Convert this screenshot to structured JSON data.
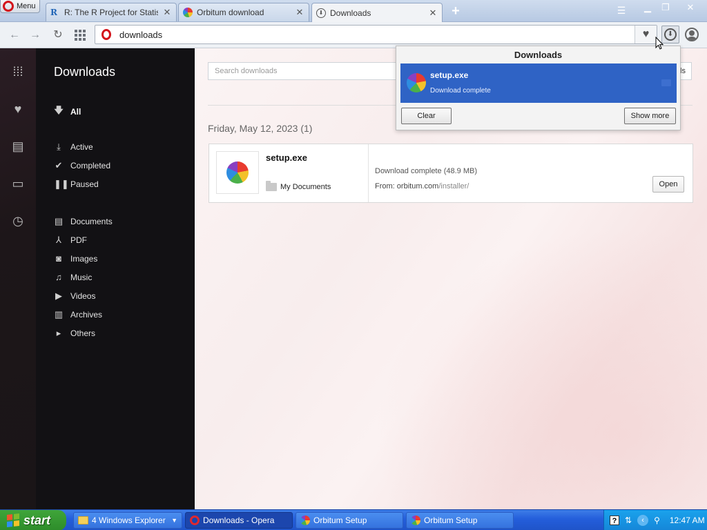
{
  "browser": {
    "menu_label": "Menu",
    "tabs": [
      {
        "title": "R: The R Project for Statistic",
        "close": "✕"
      },
      {
        "title": "Orbitum download",
        "close": "✕"
      },
      {
        "title": "Downloads",
        "close": "✕"
      }
    ],
    "new_tab": "+",
    "address": "downloads"
  },
  "sidebar": {
    "title": "Downloads",
    "filters": {
      "all": "All",
      "status": [
        "Active",
        "Completed",
        "Paused"
      ],
      "types": [
        "Documents",
        "PDF",
        "Images",
        "Music",
        "Videos",
        "Archives",
        "Others"
      ]
    }
  },
  "main": {
    "search_placeholder": "Search downloads",
    "clear_button": "ls",
    "date_heading": "Friday, May 12, 2023 (1)",
    "item": {
      "filename": "setup.exe",
      "folder": "My Documents",
      "status": "Download complete",
      "size": "(48.9 MB)",
      "from_label": "From:",
      "from_host": "orbitum.com",
      "from_path": "/installer/",
      "open_label": "Open"
    }
  },
  "popup": {
    "title": "Downloads",
    "item_name": "setup.exe",
    "item_status": "Download complete",
    "clear_label": "Clear",
    "show_more_label": "Show more"
  },
  "taskbar": {
    "start_label": "start",
    "buttons": [
      {
        "label": "4 Windows Explorer"
      },
      {
        "label": "Downloads - Opera"
      },
      {
        "label": "Orbitum Setup"
      },
      {
        "label": "Orbitum Setup"
      }
    ],
    "clock": "12:47 AM"
  },
  "colors": {
    "popup_selection": "#2f63c5",
    "sidebar_bg": "#121114",
    "opera_red": "#d3141b",
    "taskbar_blue": "#245edb",
    "start_green": "#3fa53a"
  }
}
